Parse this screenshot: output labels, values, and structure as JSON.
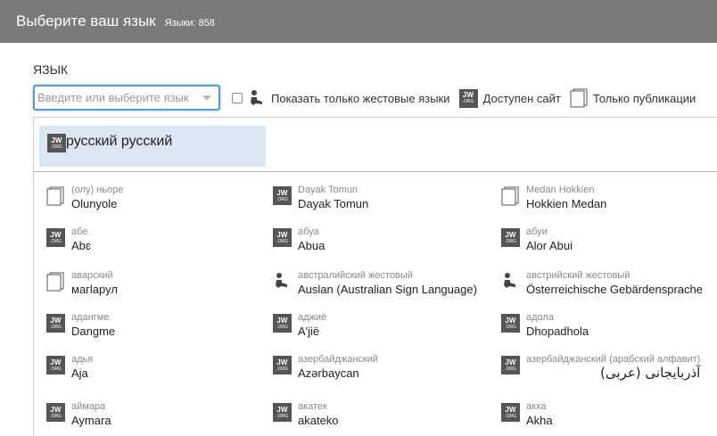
{
  "header": {
    "title": "Выберите ваш язык",
    "count_label": "Языки: 858"
  },
  "form": {
    "label": "ЯЗЫК",
    "search_placeholder": "Введите или выберите язык"
  },
  "filters": {
    "sign_only": "Показать только жестовые языки",
    "site_available": "Доступен сайт",
    "publications_only": "Только публикации"
  },
  "selected": {
    "native": "русский",
    "name": "русский",
    "icon": "jw-org-icon"
  },
  "languages": [
    {
      "native": "(олу) ньоре",
      "name": "Olunyole",
      "icon": "publication-icon"
    },
    {
      "native": "Dayak Tomun",
      "name": "Dayak Tomun",
      "icon": "jw-org-icon"
    },
    {
      "native": "Medan Hokkien",
      "name": "Hokkien Medan",
      "icon": "publication-icon"
    },
    {
      "native": "абе",
      "name": "Abɛ",
      "icon": "jw-org-icon"
    },
    {
      "native": "абуа",
      "name": "Abua",
      "icon": "jw-org-icon"
    },
    {
      "native": "абуи",
      "name": "Alor Abui",
      "icon": "jw-org-icon"
    },
    {
      "native": "аварский",
      "name": "магӏарул",
      "icon": "publication-icon"
    },
    {
      "native": "австралийский жестовый",
      "name": "Auslan (Australian Sign Language)",
      "icon": "sign-language-icon"
    },
    {
      "native": "австрийский жестовый",
      "name": "Österreichische Gebärdensprache",
      "icon": "sign-language-icon"
    },
    {
      "native": "адангме",
      "name": "Dangme",
      "icon": "jw-org-icon"
    },
    {
      "native": "аджиё",
      "name": "A'jië",
      "icon": "jw-org-icon"
    },
    {
      "native": "адола",
      "name": "Dhopadhola",
      "icon": "jw-org-icon"
    },
    {
      "native": "адья",
      "name": "Aja",
      "icon": "jw-org-icon"
    },
    {
      "native": "азербайджанский",
      "name": "Azərbaycan",
      "icon": "jw-org-icon"
    },
    {
      "native": "азербайджанский (арабский алфавит)",
      "name": "آذربایجانی (عربی)",
      "icon": "jw-org-icon"
    },
    {
      "native": "аймара",
      "name": "Aymara",
      "icon": "jw-org-icon"
    },
    {
      "native": "акатек",
      "name": "akateko",
      "icon": "jw-org-icon"
    },
    {
      "native": "акха",
      "name": "Akha",
      "icon": "jw-org-icon"
    }
  ],
  "jw_logo": {
    "line1": "JW",
    "line2": ".ORG"
  },
  "colors": {
    "header_bg": "#7a7a7a",
    "selected_bg": "#dbe7f2",
    "focus_border": "#5b9bd5",
    "logo_bg": "#555555"
  }
}
